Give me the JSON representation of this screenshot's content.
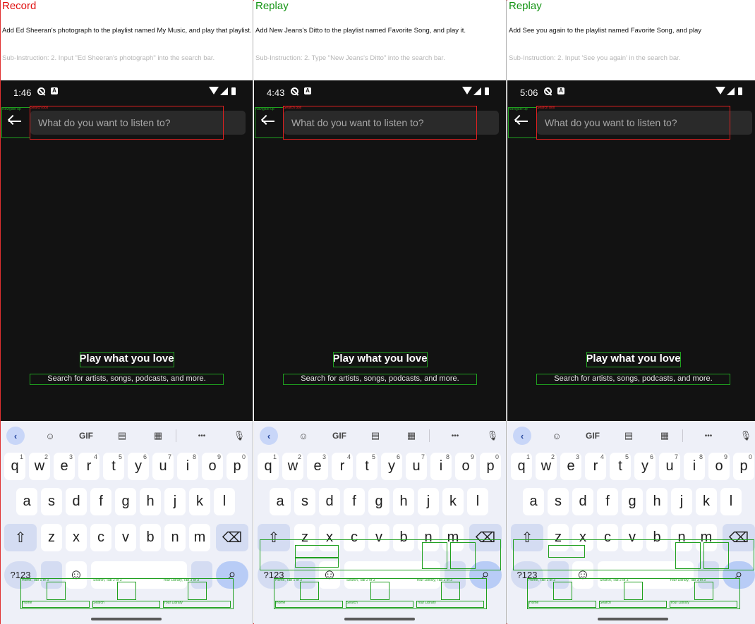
{
  "panels": [
    {
      "title": "Record",
      "title_color": "#e01010",
      "instruction": "Add Ed Sheeran's photograph to the playlist named My Music, and play that playlist.",
      "sub_instruction": "Sub-Instruction: 2. Input \"Ed Sheeran's photograph\" into the search bar.",
      "time": "1:46"
    },
    {
      "title": "Replay",
      "title_color": "#149414",
      "instruction": "Add New Jeans's Ditto to the playlist named Favorite Song, and play it.",
      "sub_instruction": "Sub-Instruction: 2. Type \"New Jeans's Ditto\" into the search bar.",
      "time": "4:43"
    },
    {
      "title": "Replay",
      "title_color": "#149414",
      "instruction": "Add See you again to the playlist named Favorite Song, and play",
      "sub_instruction": "Sub-Instruction: 2. Input 'See you again' in the search bar.",
      "time": "5:06"
    }
  ],
  "app": {
    "search_placeholder": "What do you want to listen to?",
    "empty_title": "Play what you love",
    "empty_subtitle": "Search for artists, songs, podcasts, and more."
  },
  "keyboard": {
    "toolbar": [
      "<",
      "sticker-icon",
      "GIF",
      "clipboard-icon",
      "keyboard-icon",
      "more-icon",
      "mic-icon"
    ],
    "gif_label": "GIF",
    "more_label": "•••",
    "row1": [
      "q",
      "w",
      "e",
      "r",
      "t",
      "y",
      "u",
      "i",
      "o",
      "p"
    ],
    "row1_sup": [
      "1",
      "2",
      "3",
      "4",
      "5",
      "6",
      "7",
      "8",
      "9",
      "0"
    ],
    "row2": [
      "a",
      "s",
      "d",
      "f",
      "g",
      "h",
      "j",
      "k",
      "l"
    ],
    "row3": [
      "z",
      "x",
      "c",
      "v",
      "b",
      "n",
      "m"
    ],
    "symbols_label": "?123",
    "emoji_label": "☺"
  },
  "overlay_labels": {
    "search_box": "Search box",
    "navigate_up": "Navigate up",
    "home_tab": "Home, Tab 1 of 3",
    "search_tab": "Search, Tab 2 of 3",
    "library_tab": "Your Library, Tab 3 of 3",
    "home": "Home",
    "search": "Search",
    "your_library": "Your Library"
  },
  "colors": {
    "record": "#e01010",
    "replay": "#149414",
    "box_green": "#1fa01f",
    "box_red": "#e02020",
    "app_bg": "#121212"
  }
}
